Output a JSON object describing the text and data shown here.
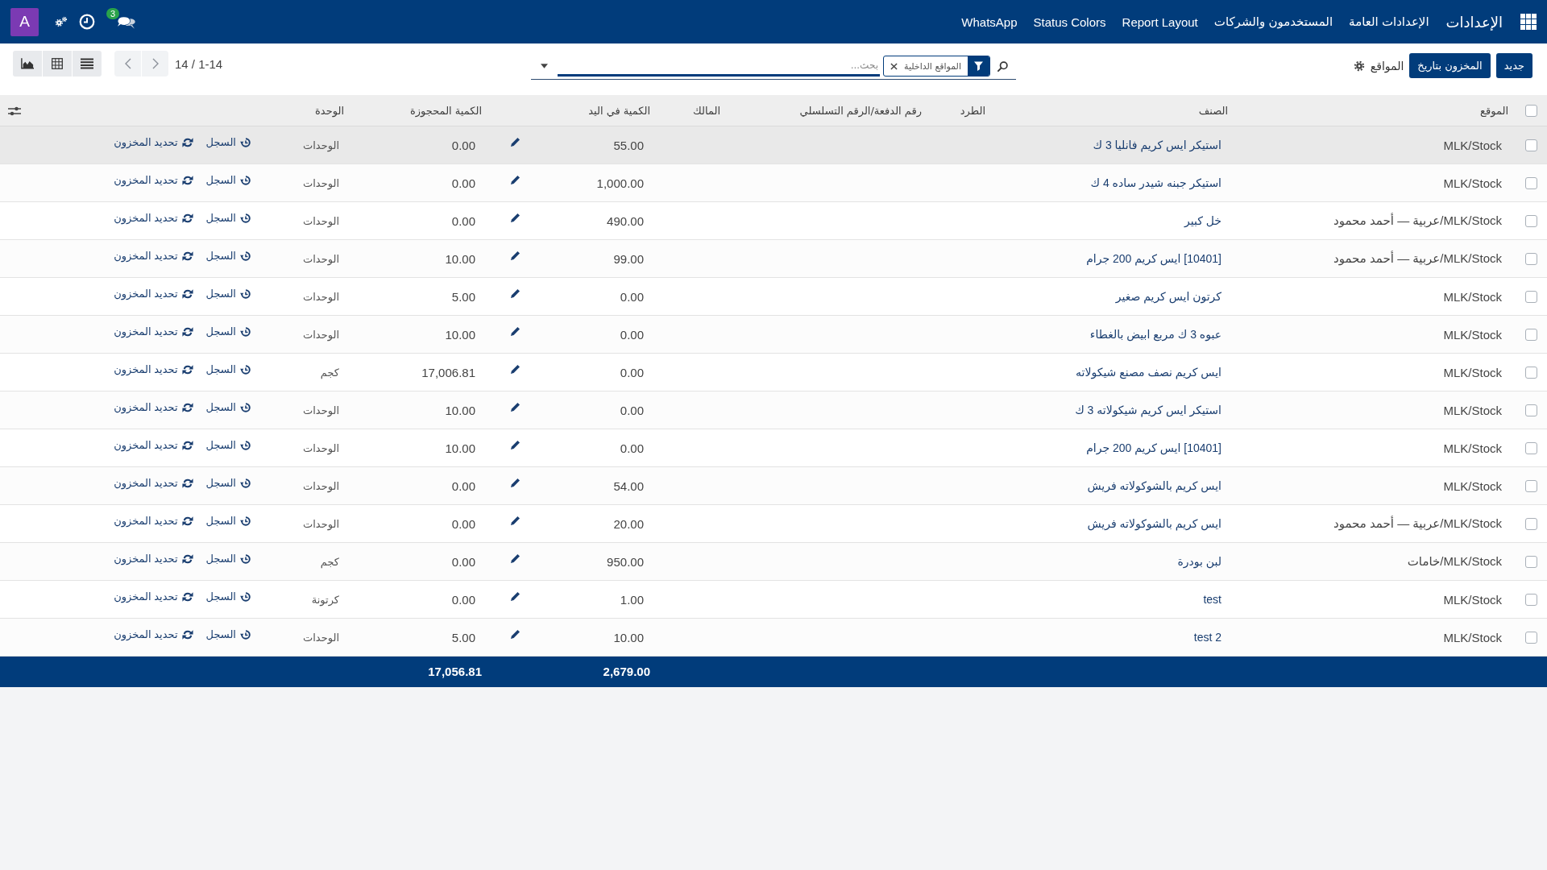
{
  "navbar": {
    "brand": "الإعدادات",
    "menu": [
      "الإعدادات العامة",
      "المستخدمون والشركات",
      "Report Layout",
      "Status Colors",
      "WhatsApp"
    ],
    "messages_badge": "3",
    "avatar": "A"
  },
  "control_panel": {
    "buttons": [
      "جديد",
      "المخزون بتاريخ"
    ],
    "title": "المواقع",
    "search": {
      "facets": [
        "المواقع الداخلية"
      ],
      "placeholder": "بحث..."
    },
    "pager": "14 / 1-14"
  },
  "table": {
    "all_checked": false,
    "columns": [
      "الموقع",
      "الصنف",
      "الطرد",
      "رقم الدفعة/الرقم التسلسلي",
      "المالك",
      "الكمية في اليد",
      "الكمية المحجوزة",
      "الوحدة"
    ],
    "rows": [
      {
        "checked": false,
        "highlighted": true,
        "location": "MLK/Stock",
        "product": "استيكر ايس كريم فانليا 3 ك",
        "on_hand": "55.00",
        "reserved": "0.00",
        "unit": "الوحدات",
        "actions": [
          {
            "kind": "history",
            "label": "السجل"
          },
          {
            "kind": "update",
            "label": "تحديد المخزون"
          }
        ]
      },
      {
        "checked": false,
        "highlighted": false,
        "location": "MLK/Stock",
        "product": "استيكر جبنه شيدر ساده 4 ك",
        "on_hand": "1,000.00",
        "reserved": "0.00",
        "unit": "الوحدات",
        "actions": [
          {
            "kind": "history",
            "label": "السجل"
          },
          {
            "kind": "update",
            "label": "تحديد المخزون"
          }
        ]
      },
      {
        "checked": false,
        "highlighted": false,
        "location": "MLK/Stock/عربية — أحمد محمود",
        "product": "خل كبير",
        "on_hand": "490.00",
        "reserved": "0.00",
        "unit": "الوحدات",
        "actions": [
          {
            "kind": "history",
            "label": "السجل"
          },
          {
            "kind": "update",
            "label": "تحديد المخزون"
          }
        ]
      },
      {
        "checked": false,
        "highlighted": false,
        "location": "MLK/Stock/عربية — أحمد محمود",
        "product": "[10401] ايس كريم 200 جرام",
        "on_hand": "99.00",
        "reserved": "10.00",
        "unit": "الوحدات",
        "actions": [
          {
            "kind": "history",
            "label": "السجل"
          },
          {
            "kind": "update",
            "label": "تحديد المخزون"
          }
        ]
      },
      {
        "checked": false,
        "highlighted": false,
        "location": "MLK/Stock",
        "product": "كرتون ايس كريم صغير",
        "on_hand": "0.00",
        "reserved": "5.00",
        "unit": "الوحدات",
        "actions": [
          {
            "kind": "history",
            "label": "السجل"
          },
          {
            "kind": "update",
            "label": "تحديد المخزون"
          }
        ]
      },
      {
        "checked": false,
        "highlighted": false,
        "location": "MLK/Stock",
        "product": "عبوه 3 ك مربع ابيض بالغطاء",
        "on_hand": "0.00",
        "reserved": "10.00",
        "unit": "الوحدات",
        "actions": [
          {
            "kind": "history",
            "label": "السجل"
          },
          {
            "kind": "update",
            "label": "تحديد المخزون"
          }
        ]
      },
      {
        "checked": false,
        "highlighted": false,
        "location": "MLK/Stock",
        "product": "ايس كريم نصف مصنع شيكولاته",
        "on_hand": "0.00",
        "reserved": "17,006.81",
        "unit": "كجم",
        "actions": [
          {
            "kind": "history",
            "label": "السجل"
          },
          {
            "kind": "update",
            "label": "تحديد المخزون"
          }
        ]
      },
      {
        "checked": false,
        "highlighted": false,
        "location": "MLK/Stock",
        "product": "استيكر ايس كريم شيكولاته 3 ك",
        "on_hand": "0.00",
        "reserved": "10.00",
        "unit": "الوحدات",
        "actions": [
          {
            "kind": "history",
            "label": "السجل"
          },
          {
            "kind": "update",
            "label": "تحديد المخزون"
          }
        ]
      },
      {
        "checked": false,
        "highlighted": false,
        "location": "MLK/Stock",
        "product": "[10401] ايس كريم 200 جرام",
        "on_hand": "0.00",
        "reserved": "10.00",
        "unit": "الوحدات",
        "actions": [
          {
            "kind": "history",
            "label": "السجل"
          },
          {
            "kind": "update",
            "label": "تحديد المخزون"
          }
        ]
      },
      {
        "checked": false,
        "highlighted": false,
        "location": "MLK/Stock",
        "product": "ايس كريم بالشوكولاته فريش",
        "on_hand": "54.00",
        "reserved": "0.00",
        "unit": "الوحدات",
        "actions": [
          {
            "kind": "history",
            "label": "السجل"
          },
          {
            "kind": "update",
            "label": "تحديد المخزون"
          }
        ]
      },
      {
        "checked": false,
        "highlighted": false,
        "location": "MLK/Stock/عربية — أحمد محمود",
        "product": "ايس كريم بالشوكولاته فريش",
        "on_hand": "20.00",
        "reserved": "0.00",
        "unit": "الوحدات",
        "actions": [
          {
            "kind": "history",
            "label": "السجل"
          },
          {
            "kind": "update",
            "label": "تحديد المخزون"
          }
        ]
      },
      {
        "checked": false,
        "highlighted": false,
        "location": "MLK/Stock/خامات",
        "product": "لبن بودرة",
        "on_hand": "950.00",
        "reserved": "0.00",
        "unit": "كجم",
        "actions": [
          {
            "kind": "history",
            "label": "السجل"
          },
          {
            "kind": "update",
            "label": "تحديد المخزون"
          }
        ]
      },
      {
        "checked": false,
        "highlighted": false,
        "location": "MLK/Stock",
        "product": "test",
        "on_hand": "1.00",
        "reserved": "0.00",
        "unit": "كرتونة",
        "actions": [
          {
            "kind": "history",
            "label": "السجل"
          },
          {
            "kind": "update",
            "label": "تحديد المخزون"
          }
        ]
      },
      {
        "checked": false,
        "highlighted": false,
        "location": "MLK/Stock",
        "product": "test 2",
        "on_hand": "10.00",
        "reserved": "5.00",
        "unit": "الوحدات",
        "actions": [
          {
            "kind": "history",
            "label": "السجل"
          },
          {
            "kind": "update",
            "label": "تحديد المخزون"
          }
        ]
      }
    ],
    "totals": {
      "on_hand": "2,679.00",
      "reserved": "17,056.81"
    }
  }
}
